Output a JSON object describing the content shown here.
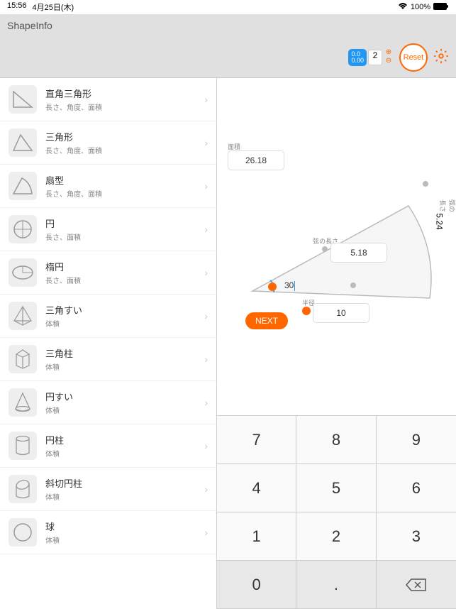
{
  "status": {
    "time": "15:56",
    "date": "4月25日(木)",
    "battery": "100%"
  },
  "app": {
    "title": "ShapeInfo"
  },
  "header": {
    "precision_label": "0.0\n0.00",
    "precision_value": "2",
    "reset": "Reset"
  },
  "shapes": [
    {
      "title": "直角三角形",
      "sub": "長さ、角度、面積"
    },
    {
      "title": "三角形",
      "sub": "長さ、角度、面積"
    },
    {
      "title": "扇型",
      "sub": "長さ、角度、面積"
    },
    {
      "title": "円",
      "sub": "長さ、面積"
    },
    {
      "title": "楕円",
      "sub": "長さ、面積"
    },
    {
      "title": "三角すい",
      "sub": "体積"
    },
    {
      "title": "三角柱",
      "sub": "体積"
    },
    {
      "title": "円すい",
      "sub": "体積"
    },
    {
      "title": "円柱",
      "sub": "体積"
    },
    {
      "title": "斜切円柱",
      "sub": "体積"
    },
    {
      "title": "球",
      "sub": "体積"
    }
  ],
  "canvas": {
    "area_label": "面積",
    "area_value": "26.18",
    "chord_label": "弦の長さ",
    "chord_value": "5.18",
    "arc_label": "弧の長さ",
    "arc_value": "5.24",
    "radius_label": "半径",
    "radius_value": "10",
    "angle_value": "30",
    "next": "NEXT"
  },
  "keypad": [
    "7",
    "8",
    "9",
    "4",
    "5",
    "6",
    "1",
    "2",
    "3",
    "0",
    ".",
    "⌫"
  ]
}
